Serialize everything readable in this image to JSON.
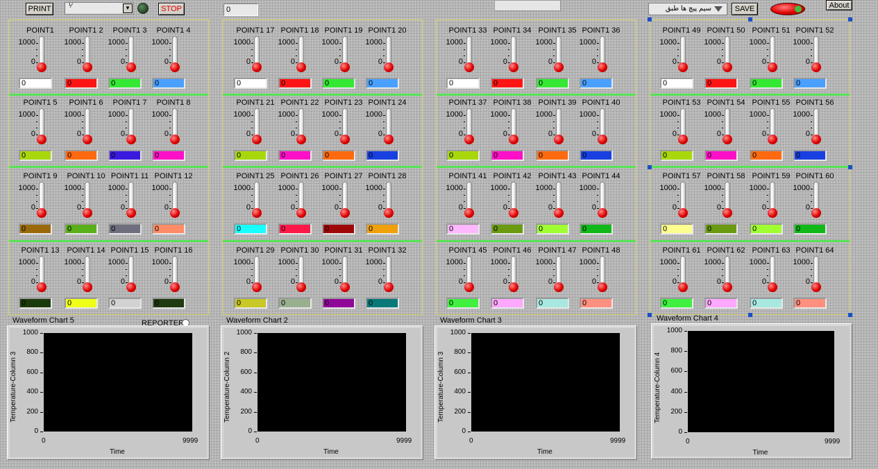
{
  "toolbar": {
    "print_label": "PRINT",
    "stop_label": "STOP",
    "ring_fraction": "⅟",
    "numeric_value": "0",
    "save_label": "SAVE",
    "about_label": "About",
    "dropdown_value": "سیم پیچ ها طبق"
  },
  "sections": [
    {
      "points": [
        {
          "label": "POINT1",
          "value": "0",
          "color": "#ffffff"
        },
        {
          "label": "POINT1 2",
          "value": "0",
          "color": "#ff1515"
        },
        {
          "label": "POINT1 3",
          "value": "0",
          "color": "#34e834"
        },
        {
          "label": "POINT1 4",
          "value": "0",
          "color": "#4aa0ff"
        },
        {
          "label": "POINT1 5",
          "value": "0",
          "color": "#a8d80c"
        },
        {
          "label": "POINT1 6",
          "value": "0",
          "color": "#ff6a10"
        },
        {
          "label": "POINT1 7",
          "value": "0",
          "color": "#3b1ae0"
        },
        {
          "label": "POINT1 8",
          "value": "0",
          "color": "#ff10c8"
        },
        {
          "label": "POINT1 9",
          "value": "0",
          "color": "#9a6a0a"
        },
        {
          "label": "POINT1 10",
          "value": "0",
          "color": "#5ab018"
        },
        {
          "label": "POINT1 11",
          "value": "0",
          "color": "#6e6e7e"
        },
        {
          "label": "POINT1 12",
          "value": "0",
          "color": "#ff8c66"
        },
        {
          "label": "POINT1 13",
          "value": "0",
          "color": "#1a3a0a"
        },
        {
          "label": "POINT1 14",
          "value": "0",
          "color": "#f0ff18"
        },
        {
          "label": "POINT1 15",
          "value": "0",
          "color": "#d2d2d2"
        },
        {
          "label": "POINT1 16",
          "value": "0",
          "color": "#1e3a0e"
        }
      ]
    },
    {
      "points": [
        {
          "label": "POINT1 17",
          "value": "0",
          "color": "#ffffff"
        },
        {
          "label": "POINT1 18",
          "value": "0",
          "color": "#ff1515"
        },
        {
          "label": "POINT1 19",
          "value": "0",
          "color": "#34e834"
        },
        {
          "label": "POINT1 20",
          "value": "0",
          "color": "#4aa0ff"
        },
        {
          "label": "POINT1 21",
          "value": "0",
          "color": "#a8d80c"
        },
        {
          "label": "POINT1 22",
          "value": "0",
          "color": "#ff10c8"
        },
        {
          "label": "POINT1 23",
          "value": "0",
          "color": "#ff6a10"
        },
        {
          "label": "POINT1 24",
          "value": "0",
          "color": "#1840e0"
        },
        {
          "label": "POINT1 25",
          "value": "0",
          "color": "#18ffff"
        },
        {
          "label": "POINT1 26",
          "value": "0",
          "color": "#ff1848"
        },
        {
          "label": "POINT1 27",
          "value": "0",
          "color": "#a00808"
        },
        {
          "label": "POINT1 28",
          "value": "0",
          "color": "#f0a008"
        },
        {
          "label": "POINT1 29",
          "value": "0",
          "color": "#c8c828"
        },
        {
          "label": "POINT1 30",
          "value": "0",
          "color": "#98b090"
        },
        {
          "label": "POINT1 31",
          "value": "0",
          "color": "#900898"
        },
        {
          "label": "POINT1 32",
          "value": "0",
          "color": "#087878"
        }
      ]
    },
    {
      "points": [
        {
          "label": "POINT1 33",
          "value": "0",
          "color": "#ffffff"
        },
        {
          "label": "POINT1 34",
          "value": "0",
          "color": "#ff1515"
        },
        {
          "label": "POINT1 35",
          "value": "0",
          "color": "#34e834"
        },
        {
          "label": "POINT1 36",
          "value": "0",
          "color": "#4aa0ff"
        },
        {
          "label": "POINT1 37",
          "value": "0",
          "color": "#a8d80c"
        },
        {
          "label": "POINT1 38",
          "value": "0",
          "color": "#ff10c8"
        },
        {
          "label": "POINT1 39",
          "value": "0",
          "color": "#ff6a10"
        },
        {
          "label": "POINT1 40",
          "value": "0",
          "color": "#1840e0"
        },
        {
          "label": "POINT1 41",
          "value": "0",
          "color": "#ffb8ff"
        },
        {
          "label": "POINT1 42",
          "value": "0",
          "color": "#6a9a10"
        },
        {
          "label": "POINT1 43",
          "value": "0",
          "color": "#a0ff30"
        },
        {
          "label": "POINT1 44",
          "value": "0",
          "color": "#10b818"
        },
        {
          "label": "POINT1 45",
          "value": "0",
          "color": "#40f040"
        },
        {
          "label": "POINT1 46",
          "value": "0",
          "color": "#ffa8ff"
        },
        {
          "label": "POINT1 47",
          "value": "0",
          "color": "#a8e8e0"
        },
        {
          "label": "POINT1 48",
          "value": "0",
          "color": "#ff9080"
        }
      ]
    },
    {
      "points": [
        {
          "label": "POINT1 49",
          "value": "0",
          "color": "#ffffff"
        },
        {
          "label": "POINT1 50",
          "value": "0",
          "color": "#ff1515"
        },
        {
          "label": "POINT1 51",
          "value": "0",
          "color": "#34e834"
        },
        {
          "label": "POINT1 52",
          "value": "0",
          "color": "#4aa0ff"
        },
        {
          "label": "POINT1 53",
          "value": "0",
          "color": "#a8d80c"
        },
        {
          "label": "POINT1 54",
          "value": "0",
          "color": "#ff10c8"
        },
        {
          "label": "POINT1 55",
          "value": "0",
          "color": "#ff6a10"
        },
        {
          "label": "POINT1 56",
          "value": "0",
          "color": "#1840e0"
        },
        {
          "label": "POINT1 57",
          "value": "0",
          "color": "#ffff90"
        },
        {
          "label": "POINT1 58",
          "value": "0",
          "color": "#6a9a10"
        },
        {
          "label": "POINT1 59",
          "value": "0",
          "color": "#a0ff30"
        },
        {
          "label": "POINT1 60",
          "value": "0",
          "color": "#10b818"
        },
        {
          "label": "POINT1 61",
          "value": "0",
          "color": "#40f040"
        },
        {
          "label": "POINT1 62",
          "value": "0",
          "color": "#ffa8ff"
        },
        {
          "label": "POINT1 63",
          "value": "0",
          "color": "#a8e8e0"
        },
        {
          "label": "POINT1 64",
          "value": "0",
          "color": "#ff9080"
        }
      ]
    }
  ],
  "thermometer_scale": {
    "max_label": "1000",
    "min_label": "0"
  },
  "reporter_label": "REPORTER",
  "charts": [
    {
      "title": "Waveform Chart 5",
      "ylabel": "Temperature-Column 3",
      "xlabel": "Time",
      "yticks": [
        "1000",
        "800",
        "600",
        "400",
        "200",
        "0"
      ],
      "xmin": "0",
      "xmax": "9999"
    },
    {
      "title": "Waveform Chart 2",
      "ylabel": "Temperature-Column 2",
      "xlabel": "Time",
      "yticks": [
        "1000",
        "800",
        "600",
        "400",
        "200",
        "0"
      ],
      "xmin": "0",
      "xmax": "9999"
    },
    {
      "title": "Waveform Chart 3",
      "ylabel": "Temperature-Column 3",
      "xlabel": "Time",
      "yticks": [
        "1000",
        "800",
        "600",
        "400",
        "200",
        "0"
      ],
      "xmin": "0",
      "xmax": "9999"
    },
    {
      "title": "Waveform Chart 4",
      "ylabel": "Temperature-Column 4",
      "xlabel": "Time",
      "yticks": [
        "1000",
        "800",
        "600",
        "400",
        "200",
        "0"
      ],
      "xmin": "0",
      "xmax": "9999"
    }
  ]
}
